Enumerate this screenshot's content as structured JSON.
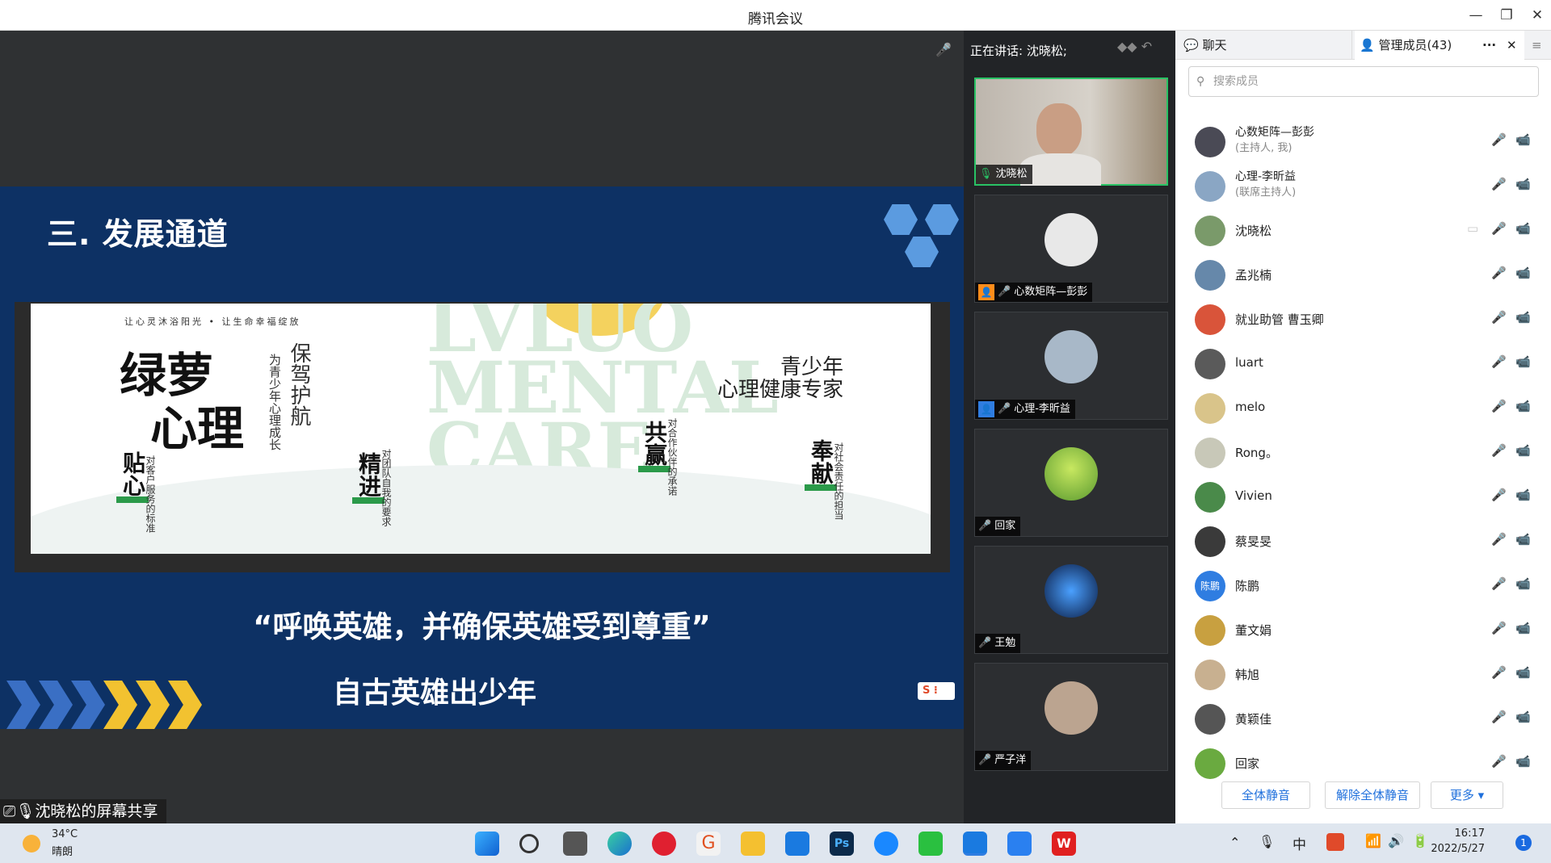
{
  "window": {
    "title": "腾讯会议",
    "min": "—",
    "max": "❐",
    "close": "✕"
  },
  "slide": {
    "title": "三. 发展通道",
    "watermark": "LVLUO\nMENTAL\nCARE",
    "slogan_top": "让心灵沐浴阳光 • 让生命幸福绽放",
    "brand_line1": "绿萝",
    "brand_line2": "心理",
    "motto_big": "保驾护航",
    "motto_small": "为青少年心理成长",
    "expert_line1": "青少年",
    "expert_line2": "心理健康专家",
    "pillars": [
      {
        "word": "贴心",
        "desc": "对客户服务的标准"
      },
      {
        "word": "精进",
        "desc": "对团队自我的要求"
      },
      {
        "word": "共赢",
        "desc": "对合作伙伴的承诺"
      },
      {
        "word": "奉献",
        "desc": "对社会责任的担当"
      }
    ],
    "quote": "“呼唤英雄，并确保英雄受到尊重”",
    "subquote": "自古英雄出少年",
    "sogou": "S ⁝"
  },
  "share_label": "沈晓松的屏幕共享",
  "speaking": "正在讲话: 沈晓松;",
  "videos": [
    {
      "name": "沈晓松",
      "mic": "on"
    },
    {
      "name": "心数矩阵—彭彭",
      "mic": "off",
      "host": true
    },
    {
      "name": "心理-李昕益",
      "mic": "off",
      "cohost": true
    },
    {
      "name": "回家",
      "mic": "off"
    },
    {
      "name": "王勉",
      "mic": "off"
    },
    {
      "name": "严子洋",
      "mic": "off"
    }
  ],
  "panel": {
    "tab_chat": "聊天",
    "tab_members": "管理成员(43)",
    "more": "···",
    "close": "✕",
    "menu": "≡",
    "search_placeholder": "搜索成员",
    "members": [
      {
        "name": "心数矩阵—彭彭",
        "role": "(主持人, 我)",
        "color": "#4a4a55"
      },
      {
        "name": "心理-李昕益",
        "role": "(联席主持人)",
        "color": "#8aa6c4"
      },
      {
        "name": "沈晓松",
        "role": "",
        "color": "#7a9a6a"
      },
      {
        "name": "孟兆楠",
        "role": "",
        "color": "#6688aa"
      },
      {
        "name": "就业助管 曹玉卿",
        "role": "",
        "color": "#d9543a"
      },
      {
        "name": "luart",
        "role": "",
        "color": "#5a5a5a"
      },
      {
        "name": "melo",
        "role": "",
        "color": "#d9c48a"
      },
      {
        "name": "Rong。",
        "role": "",
        "color": "#c8c8b8"
      },
      {
        "name": "Vivien",
        "role": "",
        "color": "#4a8a4a"
      },
      {
        "name": "蔡旻旻",
        "role": "",
        "color": "#3a3a3a"
      },
      {
        "name": "陈鹏",
        "role": "",
        "color": "#2f7de1",
        "initials": "陈鹏"
      },
      {
        "name": "董文娟",
        "role": "",
        "color": "#c8a040"
      },
      {
        "name": "韩旭",
        "role": "",
        "color": "#c8b090"
      },
      {
        "name": "黄颖佳",
        "role": "",
        "color": "#555555"
      },
      {
        "name": "回家",
        "role": "",
        "color": "#6aaa40"
      }
    ],
    "btn_mute_all": "全体静音",
    "btn_unmute_all": "解除全体静音",
    "btn_more": "更多 ▾"
  },
  "taskbar": {
    "temp": "34°C",
    "weather": "晴朗",
    "ime": "中",
    "time": "16:17",
    "date": "2022/5/27",
    "notif": "1"
  }
}
